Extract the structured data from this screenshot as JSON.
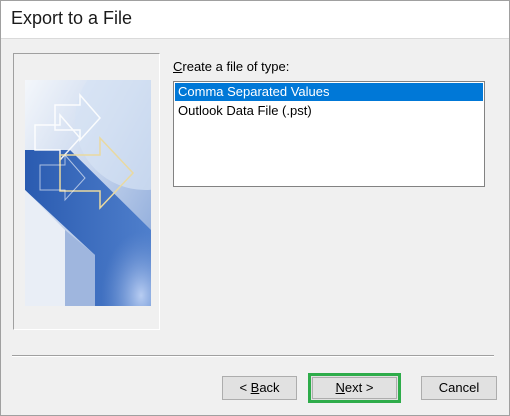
{
  "window": {
    "title": "Export to a File"
  },
  "form": {
    "type_label_first": "C",
    "type_label_rest": "reate a file of type:",
    "options": [
      {
        "label": "Comma Separated Values",
        "selected": true
      },
      {
        "label": "Outlook Data File (.pst)",
        "selected": false
      }
    ]
  },
  "buttons": {
    "back_prefix": "< ",
    "back_accel": "B",
    "back_rest": "ack",
    "next_accel": "N",
    "next_rest": "ext >",
    "cancel": "Cancel"
  },
  "colors": {
    "selection": "#0078d7",
    "highlight_border": "#2eac4a",
    "art_blue": "#2f5fae"
  },
  "icons": [
    "export-wizard-art"
  ]
}
